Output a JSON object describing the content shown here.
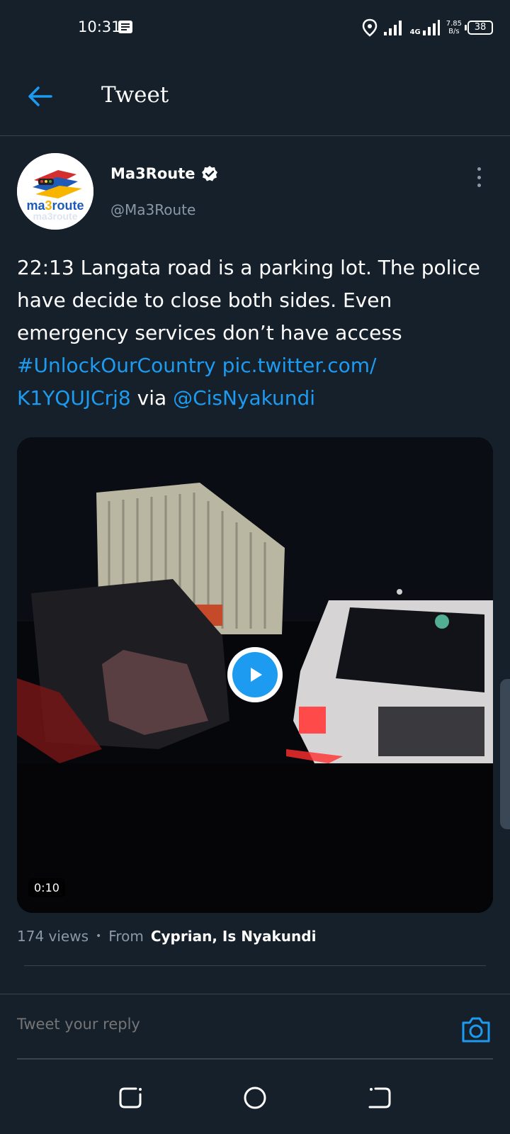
{
  "status_bar": {
    "time": "10:31",
    "network_type": "4G",
    "speed_value": "7.85",
    "speed_unit": "B/s",
    "battery": "38"
  },
  "header": {
    "title": "Tweet",
    "back_icon": "arrow-left-icon"
  },
  "author": {
    "name": "Ma3Route",
    "handle": "@Ma3Route",
    "verified": true,
    "avatar_text": "ma3route"
  },
  "tweet": {
    "text_main": "22:13 Langata road is a parking lot. The police have decide to close both sides. Even emergency services don’t have access",
    "hashtag": "#UnlockOurCountry",
    "pic_link": "pic.twitter.com/ K1YQUJCrj8",
    "via_label": "via",
    "mention": "@CisNyakundi"
  },
  "media": {
    "type": "video",
    "duration": "0:10",
    "play_icon": "play-icon"
  },
  "meta": {
    "views": "174 views",
    "separator": "•",
    "from_label": "From",
    "from_name": "Cyprian, Is Nyakundi"
  },
  "reply": {
    "placeholder": "Tweet your reply",
    "camera_icon": "camera-icon"
  },
  "nav": {
    "recents_icon": "recents-icon",
    "home_icon": "home-circle-icon",
    "back_icon": "nav-back-icon"
  },
  "colors": {
    "background": "#15202b",
    "accent": "#1d9bf0",
    "secondary_text": "#8b98a5",
    "divider": "#38444d"
  }
}
